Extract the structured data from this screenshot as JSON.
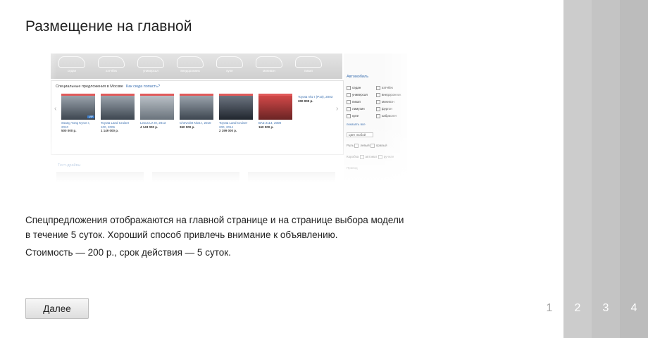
{
  "dialog": {
    "title": "Размещение на главной",
    "description": "Спецпредложения отображаются на главной странице и на странице выбора модели в течение 5 суток. Хороший способ привлечь внимание к объявлению.",
    "price": "Стоимость — 200 р., срок действия — 5 суток.",
    "next_button": "Далее",
    "close_icon": "close-icon"
  },
  "steps": [
    {
      "label": "1",
      "active": true
    },
    {
      "label": "2",
      "active": false
    },
    {
      "label": "3",
      "active": false
    },
    {
      "label": "4",
      "active": false
    }
  ],
  "preview": {
    "categories": [
      "седан",
      "хэтчбек",
      "универсал",
      "внедорожник",
      "купе",
      "минивэн",
      "пикап"
    ],
    "heading": "Специальные предложения в Москве",
    "heading_link": "Как сюда попасть?",
    "offers": [
      {
        "caption": "Ssang Yong Kyron I, 2010",
        "price": "500 000 р."
      },
      {
        "caption": "Toyota Land Cruiser 100, 2006",
        "price": "1 149 000 р."
      },
      {
        "caption": "Lexus LX III, 2013",
        "price": "4 143 000 р."
      },
      {
        "caption": "Chevrolet Niva I, 2010",
        "price": "360 000 р."
      },
      {
        "caption": "Toyota Land Cruiser 200, 2014",
        "price": "2 199 000 р."
      },
      {
        "caption": "ВАЗ 2114, 2008",
        "price": "160 000 р."
      },
      {
        "caption": "Toyota Vitz I (P10), 2003",
        "price": "300 000 р."
      }
    ],
    "side_title": "Автомобиль",
    "side_rows": [
      "седан",
      "хэтчбек",
      "универсал",
      "внедорожник",
      "пикап",
      "минивэн",
      "лимузин",
      "фургон",
      "купе",
      "кабриолет"
    ],
    "side_more": "показать все",
    "side_color": "цвет любой",
    "side_wheel": "Руль",
    "side_wheel_opts": [
      "левый",
      "правый"
    ],
    "side_gear": "Коробка",
    "side_gear_opts": [
      "автомат",
      "ручная"
    ],
    "side_drive": "Привод",
    "test_drives": "Тест-драйвы"
  }
}
